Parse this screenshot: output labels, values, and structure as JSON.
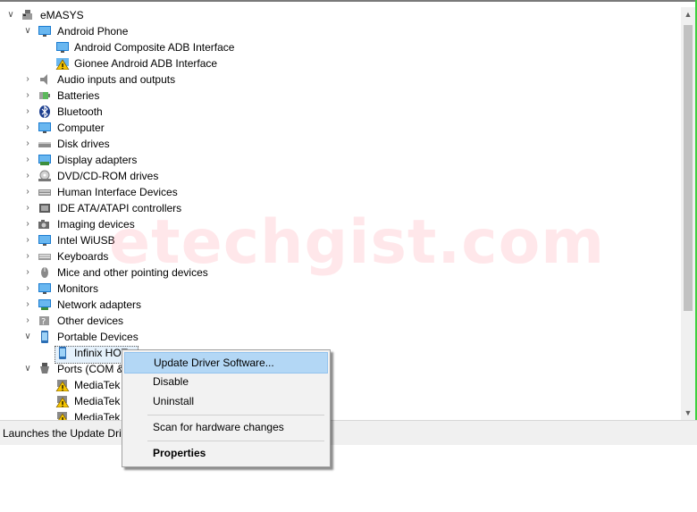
{
  "tree": {
    "root": {
      "label": "eMASYS",
      "icon": "computer-icon"
    },
    "items": [
      {
        "label": "Android Phone",
        "icon": "monitor-icon",
        "expanded": true,
        "children": [
          {
            "label": "Android Composite ADB Interface",
            "icon": "device-icon"
          },
          {
            "label": "Gionee Android ADB Interface",
            "icon": "warning-icon"
          }
        ]
      },
      {
        "label": "Audio inputs and outputs",
        "icon": "speaker-icon"
      },
      {
        "label": "Batteries",
        "icon": "battery-icon"
      },
      {
        "label": "Bluetooth",
        "icon": "bluetooth-icon"
      },
      {
        "label": "Computer",
        "icon": "monitor-icon"
      },
      {
        "label": "Disk drives",
        "icon": "disk-icon"
      },
      {
        "label": "Display adapters",
        "icon": "display-icon"
      },
      {
        "label": "DVD/CD-ROM drives",
        "icon": "dvd-icon"
      },
      {
        "label": "Human Interface Devices",
        "icon": "hid-icon"
      },
      {
        "label": "IDE ATA/ATAPI controllers",
        "icon": "ide-icon"
      },
      {
        "label": "Imaging devices",
        "icon": "camera-icon"
      },
      {
        "label": "Intel WiUSB",
        "icon": "monitor-icon"
      },
      {
        "label": "Keyboards",
        "icon": "keyboard-icon"
      },
      {
        "label": "Mice and other pointing devices",
        "icon": "mouse-icon"
      },
      {
        "label": "Monitors",
        "icon": "monitor-icon"
      },
      {
        "label": "Network adapters",
        "icon": "network-icon"
      },
      {
        "label": "Other devices",
        "icon": "unknown-device-icon"
      },
      {
        "label": "Portable Devices",
        "icon": "phone-icon",
        "expanded": true,
        "children": [
          {
            "label": "Infinix HOT",
            "icon": "phone-icon",
            "selected": true
          }
        ]
      },
      {
        "label": "Ports (COM &",
        "icon": "port-icon",
        "expanded": true,
        "children": [
          {
            "label": "MediaTek",
            "icon": "warning-icon"
          },
          {
            "label": "MediaTek",
            "icon": "warning-icon"
          },
          {
            "label": "MediaTek",
            "icon": "warning-icon"
          }
        ]
      }
    ]
  },
  "status_text": "Launches the Update Drive",
  "watermark": "etechgist.com",
  "context_menu": {
    "items": [
      {
        "label": "Update Driver Software...",
        "highlighted": true
      },
      {
        "label": "Disable"
      },
      {
        "label": "Uninstall"
      },
      {
        "label": "Scan for hardware changes"
      },
      {
        "label": "Properties",
        "bold": true
      }
    ]
  },
  "colors": {
    "selection": "#b3d7f5",
    "watermark": "#ff788c",
    "scrollbar_thumb": "#c1c1c1"
  }
}
